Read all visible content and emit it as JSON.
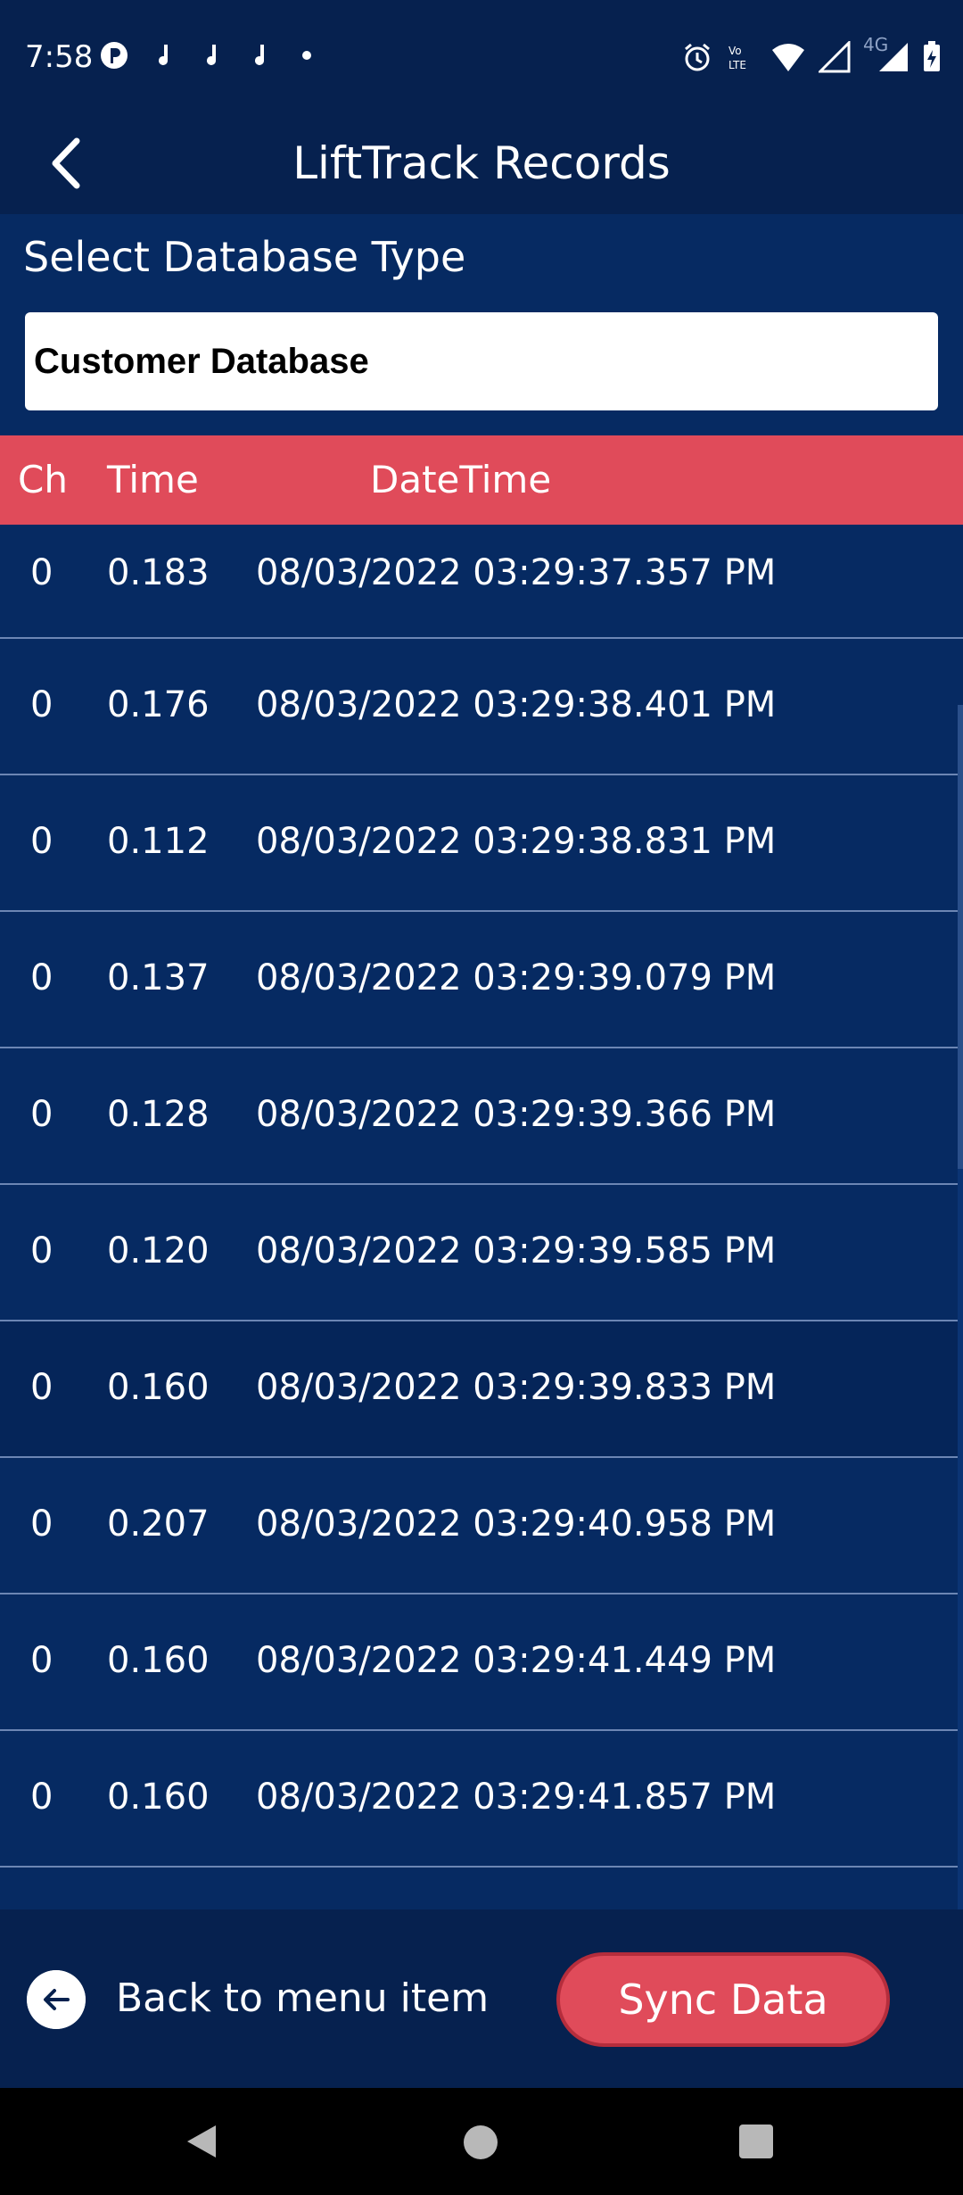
{
  "status_bar": {
    "time": "7:58",
    "network": "4G",
    "icons_left": [
      "p-circle-icon",
      "music-note-icon",
      "music-note-icon",
      "music-note-icon",
      "dot-icon"
    ],
    "icons_right": [
      "alarm-icon",
      "volte-icon",
      "wifi-icon",
      "signal-icon",
      "signal-4g-icon",
      "battery-charging-icon"
    ]
  },
  "app_bar": {
    "title": "LiftTrack Records",
    "back_icon": "chevron-left-icon"
  },
  "database": {
    "label": "Select Database Type",
    "selected": "Customer Database"
  },
  "table": {
    "headers": {
      "ch": "Ch",
      "time": "Time",
      "datetime": "DateTime"
    },
    "rows": [
      {
        "ch": "0",
        "time": "0.183",
        "datetime": "08/03/2022 03:29:37.357 PM"
      },
      {
        "ch": "0",
        "time": "0.176",
        "datetime": "08/03/2022 03:29:38.401 PM"
      },
      {
        "ch": "0",
        "time": "0.112",
        "datetime": "08/03/2022 03:29:38.831 PM"
      },
      {
        "ch": "0",
        "time": "0.137",
        "datetime": "08/03/2022 03:29:39.079 PM"
      },
      {
        "ch": "0",
        "time": "0.128",
        "datetime": "08/03/2022 03:29:39.366 PM"
      },
      {
        "ch": "0",
        "time": "0.120",
        "datetime": "08/03/2022 03:29:39.585 PM"
      },
      {
        "ch": "0",
        "time": "0.160",
        "datetime": "08/03/2022 03:29:39.833 PM"
      },
      {
        "ch": "0",
        "time": "0.207",
        "datetime": "08/03/2022 03:29:40.958 PM"
      },
      {
        "ch": "0",
        "time": "0.160",
        "datetime": "08/03/2022 03:29:41.449 PM"
      },
      {
        "ch": "0",
        "time": "0.160",
        "datetime": "08/03/2022 03:29:41.857 PM"
      }
    ]
  },
  "bottom_bar": {
    "back_label": "Back to menu item",
    "back_icon": "arrow-left-circle-icon",
    "sync_label": "Sync Data"
  },
  "colors": {
    "background": "#062a62",
    "bar": "#06214f",
    "accent": "#e04b5a",
    "divider": "#6c86b4"
  }
}
